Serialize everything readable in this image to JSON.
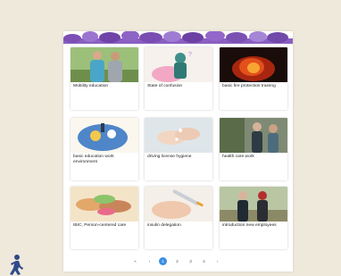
{
  "cards": [
    {
      "title": "Mobility education",
      "meta": [
        "",
        ""
      ]
    },
    {
      "title": "State of confusion",
      "meta": [
        "",
        ""
      ]
    },
    {
      "title": "basic fire protection training",
      "meta": [
        "",
        ""
      ]
    },
    {
      "title": "basic education work environment",
      "meta": [
        "",
        ""
      ]
    },
    {
      "title": "driving license hygiene",
      "meta": [
        "",
        ""
      ]
    },
    {
      "title": "health care work",
      "meta": [
        "",
        ""
      ]
    },
    {
      "title": "IBIC, Person-centered care",
      "meta": [
        "",
        ""
      ]
    },
    {
      "title": "insulin delegation",
      "meta": [
        "",
        ""
      ]
    },
    {
      "title": "introduction new employees",
      "meta": [
        "",
        ""
      ]
    }
  ],
  "pagination": {
    "prev_first": "«",
    "prev": "‹",
    "pages": [
      "1",
      "2",
      "3",
      "4"
    ],
    "current_page": "1",
    "next": "›"
  },
  "colors": {
    "accent": "#3d8fe3",
    "banner": "#7d4fb4",
    "background": "#efe9dc"
  },
  "icons": {
    "walker": "walking-person-icon"
  }
}
